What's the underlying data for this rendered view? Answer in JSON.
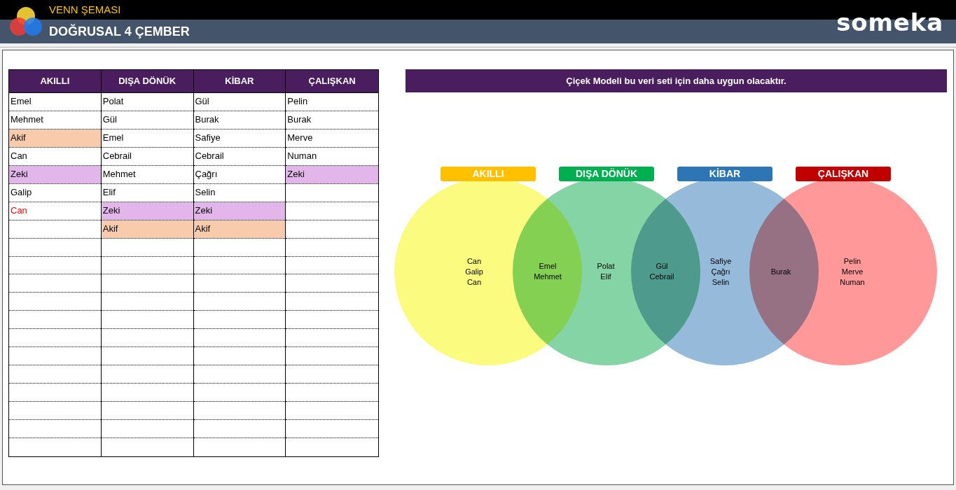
{
  "header": {
    "app_title": "VENN ŞEMASI",
    "page_title": "DOĞRUSAL 4 ÇEMBER",
    "brand": "someka"
  },
  "table": {
    "columns": [
      {
        "header": "AKILLI",
        "cells": [
          {
            "text": "Emel"
          },
          {
            "text": "Mehmet"
          },
          {
            "text": "Akif",
            "fill": {
              "color": "#f8cbad"
            }
          },
          {
            "text": "Can"
          },
          {
            "text": "Zeki",
            "fill": {
              "color": "#e2b6ea"
            }
          },
          {
            "text": "Galip"
          },
          {
            "text": "Can",
            "font": {
              "color": "#ff0000"
            }
          }
        ]
      },
      {
        "header": "DIŞA DÖNÜK",
        "cells": [
          {
            "text": "Polat"
          },
          {
            "text": "Gül"
          },
          {
            "text": "Emel"
          },
          {
            "text": "Cebrail"
          },
          {
            "text": "Mehmet"
          },
          {
            "text": "Elif"
          },
          {
            "text": "Zeki",
            "fill": {
              "color": "#e2b6ea"
            }
          },
          {
            "text": "Akif",
            "fill": {
              "color": "#f8cbad"
            }
          }
        ]
      },
      {
        "header": "KİBAR",
        "cells": [
          {
            "text": "Gül"
          },
          {
            "text": "Burak"
          },
          {
            "text": "Safiye"
          },
          {
            "text": "Cebrail"
          },
          {
            "text": "Çağrı"
          },
          {
            "text": "Selin"
          },
          {
            "text": "Zeki",
            "fill": {
              "color": "#e2b6ea"
            }
          },
          {
            "text": "Akif",
            "fill": {
              "color": "#f8cbad"
            }
          }
        ]
      },
      {
        "header": "ÇALIŞKAN",
        "cells": [
          {
            "text": "Pelin"
          },
          {
            "text": "Burak"
          },
          {
            "text": "Merve"
          },
          {
            "text": "Numan"
          },
          {
            "text": "Zeki",
            "fill": {
              "color": "#e2b6ea"
            }
          }
        ]
      }
    ]
  },
  "note": "Çiçek Modeli bu veri seti için daha uygun olacaktır.",
  "venn": {
    "sets": [
      {
        "label": "AKILLI",
        "color": "#ffc000",
        "circle": {
          "color": "#fbfb7f"
        }
      },
      {
        "label": "DIŞA DÖNÜK",
        "color": "#00b050",
        "circle": {
          "color": "#85d4a6"
        }
      },
      {
        "label": "KİBAR",
        "color": "#2e75b6",
        "circle": {
          "color": "#96bada"
        }
      },
      {
        "label": "ÇALIŞKAN",
        "color": "#c00000",
        "circle": {
          "color": "#ff9999"
        }
      }
    ],
    "regions": [
      {
        "names": [
          "Can",
          "Galip",
          "Can"
        ]
      },
      {
        "names": [
          "Emel",
          "Mehmet"
        ]
      },
      {
        "names": [
          "Polat",
          "Elif"
        ]
      },
      {
        "names": [
          "Gül",
          "Cebrail"
        ]
      },
      {
        "names": [
          "Safiye",
          "Çağrı",
          "Selin"
        ]
      },
      {
        "names": [
          "Burak"
        ]
      },
      {
        "names": [
          "Pelin",
          "Merve",
          "Numan"
        ]
      }
    ]
  }
}
